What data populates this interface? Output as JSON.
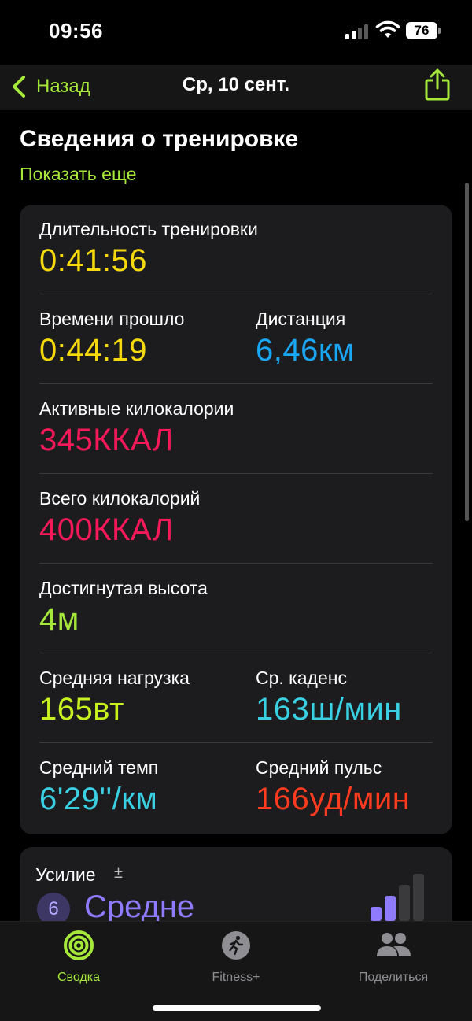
{
  "status": {
    "time": "09:56",
    "battery": "76"
  },
  "nav": {
    "back_label": "Назад",
    "title": "Ср, 10 сент."
  },
  "section": {
    "title": "Сведения о тренировке",
    "show_more": "Показать еще"
  },
  "metrics": {
    "duration": {
      "label": "Длительность тренировки",
      "value": "0:41:56",
      "color": "#f5d90a"
    },
    "elapsed": {
      "label": "Времени прошло",
      "value": "0:44:19",
      "color": "#f5d90a"
    },
    "distance": {
      "label": "Дистанция",
      "value": "6,46км",
      "color": "#19a7f5"
    },
    "active_kcal": {
      "label": "Активные килокалории",
      "value": "345ККАЛ",
      "color": "#f5195a"
    },
    "total_kcal": {
      "label": "Всего килокалорий",
      "value": "400ККАЛ",
      "color": "#f5195a"
    },
    "elevation": {
      "label": "Достигнутая высота",
      "value": "4м",
      "color": "#a6e83a"
    },
    "avg_power": {
      "label": "Средняя нагрузка",
      "value": "165вт",
      "color": "#c8f21e"
    },
    "cadence": {
      "label": "Ср. каденс",
      "value": "163ш/мин",
      "color": "#3ad0e4"
    },
    "avg_pace": {
      "label": "Средний темп",
      "value": "6'29''/км",
      "color": "#3ad0e4"
    },
    "avg_hr": {
      "label": "Средний пульс",
      "value": "166уд/мин",
      "color": "#ff3b1f"
    }
  },
  "effort": {
    "label": "Усилие",
    "icon": "plus-minus-icon",
    "score": "6",
    "value": "Средне",
    "level_fraction": 0.6,
    "color": "#8f7bff"
  },
  "tabs": [
    {
      "label": "Сводка",
      "icon": "activity-rings-icon",
      "active": true,
      "color": "#a6e83a"
    },
    {
      "label": "Fitness+",
      "icon": "runner-icon",
      "active": false,
      "color": "#8e8e93"
    },
    {
      "label": "Поделиться",
      "icon": "people-icon",
      "active": false,
      "color": "#8e8e93"
    }
  ]
}
